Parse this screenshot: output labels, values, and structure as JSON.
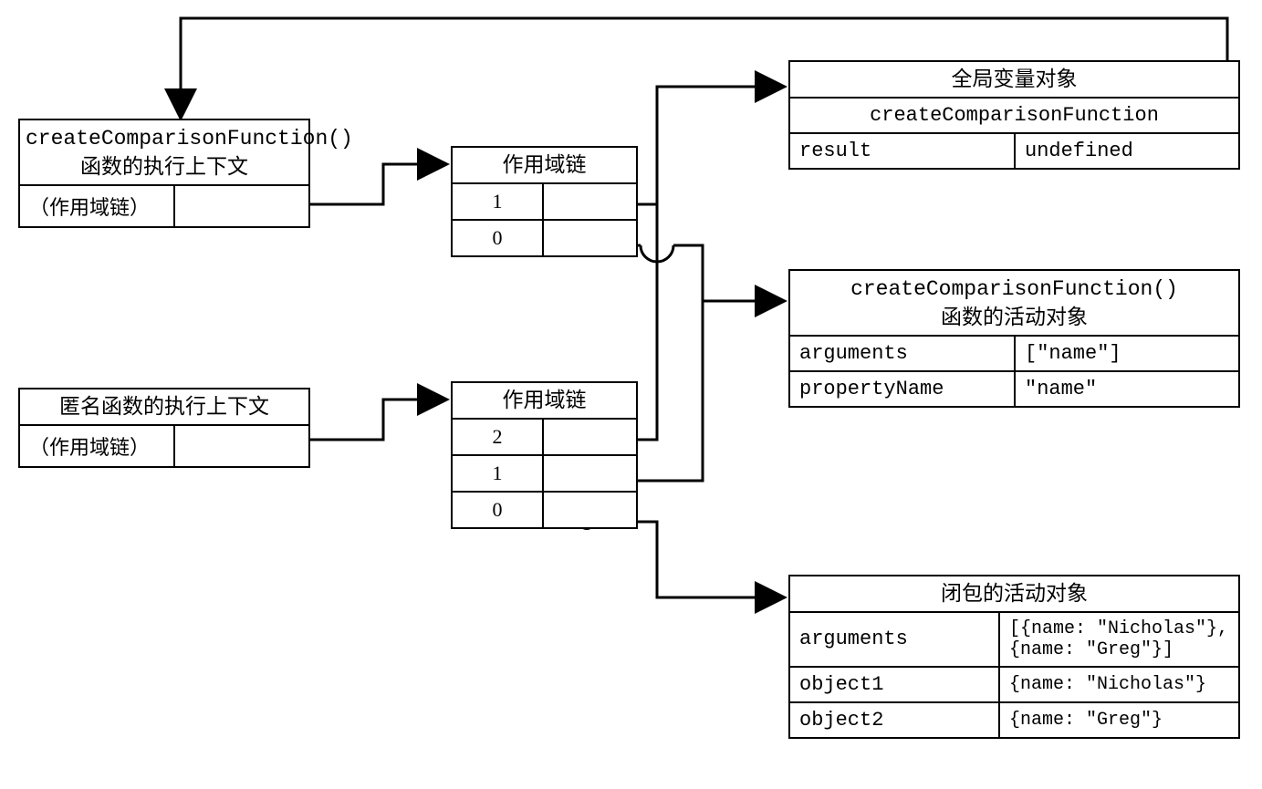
{
  "ctx1": {
    "title_line1": "createComparisonFunction()",
    "title_line2": "函数的执行上下文",
    "row_label": "（作用域链）"
  },
  "ctx2": {
    "title": "匿名函数的执行上下文",
    "row_label": "（作用域链）"
  },
  "chain1": {
    "title": "作用域链",
    "i0": "1",
    "i1": "0"
  },
  "chain2": {
    "title": "作用域链",
    "i0": "2",
    "i1": "1",
    "i2": "0"
  },
  "global": {
    "title": "全局变量对象",
    "r0k": "createComparisonFunction",
    "r1k": "result",
    "r1v": "undefined"
  },
  "act1": {
    "title_line1": "createComparisonFunction()",
    "title_line2": "函数的活动对象",
    "r0k": "arguments",
    "r0v": "[\"name\"]",
    "r1k": "propertyName",
    "r1v": "\"name\""
  },
  "closure": {
    "title": "闭包的活动对象",
    "r0k": "arguments",
    "r0v": "[{name: \"Nicholas\"},\n{name: \"Greg\"}]",
    "r1k": "object1",
    "r1v": "{name: \"Nicholas\"}",
    "r2k": "object2",
    "r2v": "{name: \"Greg\"}"
  }
}
